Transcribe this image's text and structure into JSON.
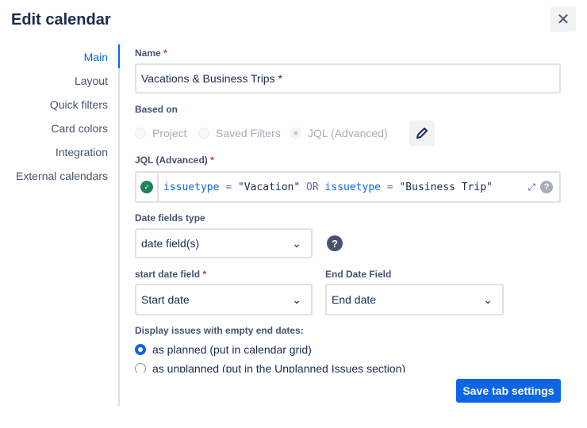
{
  "dialog": {
    "title": "Edit calendar",
    "close_icon": "close-icon"
  },
  "nav": {
    "items": [
      {
        "label": "Main",
        "active": true
      },
      {
        "label": "Layout"
      },
      {
        "label": "Quick filters"
      },
      {
        "label": "Card colors"
      },
      {
        "label": "Integration"
      },
      {
        "label": "External calendars"
      }
    ]
  },
  "form": {
    "name_label": "Name",
    "name_value": "Vacations & Business Trips *",
    "based_on_label": "Based on",
    "based_on_options": [
      "Project",
      "Saved Filters",
      "JQL (Advanced)"
    ],
    "based_on_selected": "JQL (Advanced)",
    "jql_label": "JQL (Advanced)",
    "jql_parts": [
      "issuetype",
      " = ",
      "\"Vacation\"",
      " OR ",
      "issuetype",
      " = ",
      "\"Business Trip\""
    ],
    "date_type_label": "Date fields type",
    "date_type_value": "date field(s)",
    "start_label": "start date field",
    "start_value": "Start date",
    "end_label": "End Date Field",
    "end_value": "End date",
    "empty_label": "Display issues with empty end dates:",
    "empty_options": [
      "as planned (put in calendar grid)",
      "as unplanned (put in the Unplanned Issues section)"
    ],
    "empty_selected": "as planned (put in calendar grid)"
  },
  "save_label": "Save tab settings",
  "colors": {
    "accent": "#0c66e4",
    "valid": "#1f845a"
  }
}
